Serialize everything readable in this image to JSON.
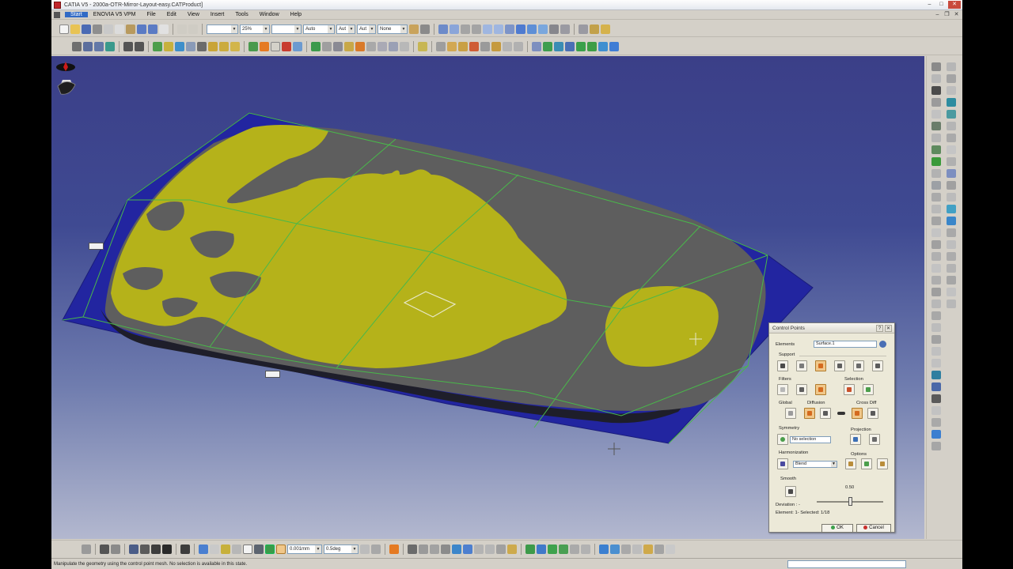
{
  "window": {
    "title": "CATIA V5 - 2000a-OTR-Mirror-Layout-easy.CATProduct]",
    "minimize": "–",
    "maximize": "□",
    "close": "✕"
  },
  "menu": {
    "items": [
      "Start",
      "ENOVIA V5 VPM",
      "File",
      "Edit",
      "View",
      "Insert",
      "Tools",
      "Window",
      "Help"
    ]
  },
  "toolbar": {
    "combo_color": "",
    "combo_opacity": "25%",
    "combo_linetype": "",
    "combo_thickness": "Auto",
    "combo_style": "Aut",
    "combo_layer": "Aut",
    "combo_render": "None"
  },
  "viewport": {
    "tag_left": "​",
    "tag_bottom": "​"
  },
  "dialog": {
    "title": "Control Points",
    "elements_label": "Elements",
    "elements_value": "Surface.1",
    "support_label": "Support",
    "filters_label": "Filters",
    "selection_label": "Selection",
    "global_label": "Global",
    "diffusion_label": "Diffusion",
    "crossdiff_label": "Cross Diff",
    "symmetry_label": "Symmetry",
    "symmetry_value": "No selection",
    "projection_label": "Projection",
    "harmonization_label": "Harmonization",
    "harmonization_value": "Blend",
    "options_label": "Options",
    "smooth_label": "Smooth",
    "smooth_value": "0.50",
    "smooth_level": 0.5,
    "deviation_label": "Deviation : -",
    "element_status": "Element: 1- Selected: 1/18",
    "ok_label": "OK",
    "cancel_label": "Cancel"
  },
  "bottom": {
    "combo_tolerance": "0.001mm",
    "combo_angle": "0.5deg"
  },
  "status": {
    "message": "Manipulate the geometry using the control point mesh. No selection is available in this state."
  },
  "colors": {
    "surface_gray": "#5e5e5e",
    "deviation_yellow": "#b5b21a",
    "border_blue": "#2225a0",
    "mesh_green": "#49b84a",
    "background_top": "#3b3f88",
    "background_bottom": "#b3b8cf"
  },
  "icons": {
    "compass": "compass-icon",
    "crosshair": "crosshair-icon"
  }
}
